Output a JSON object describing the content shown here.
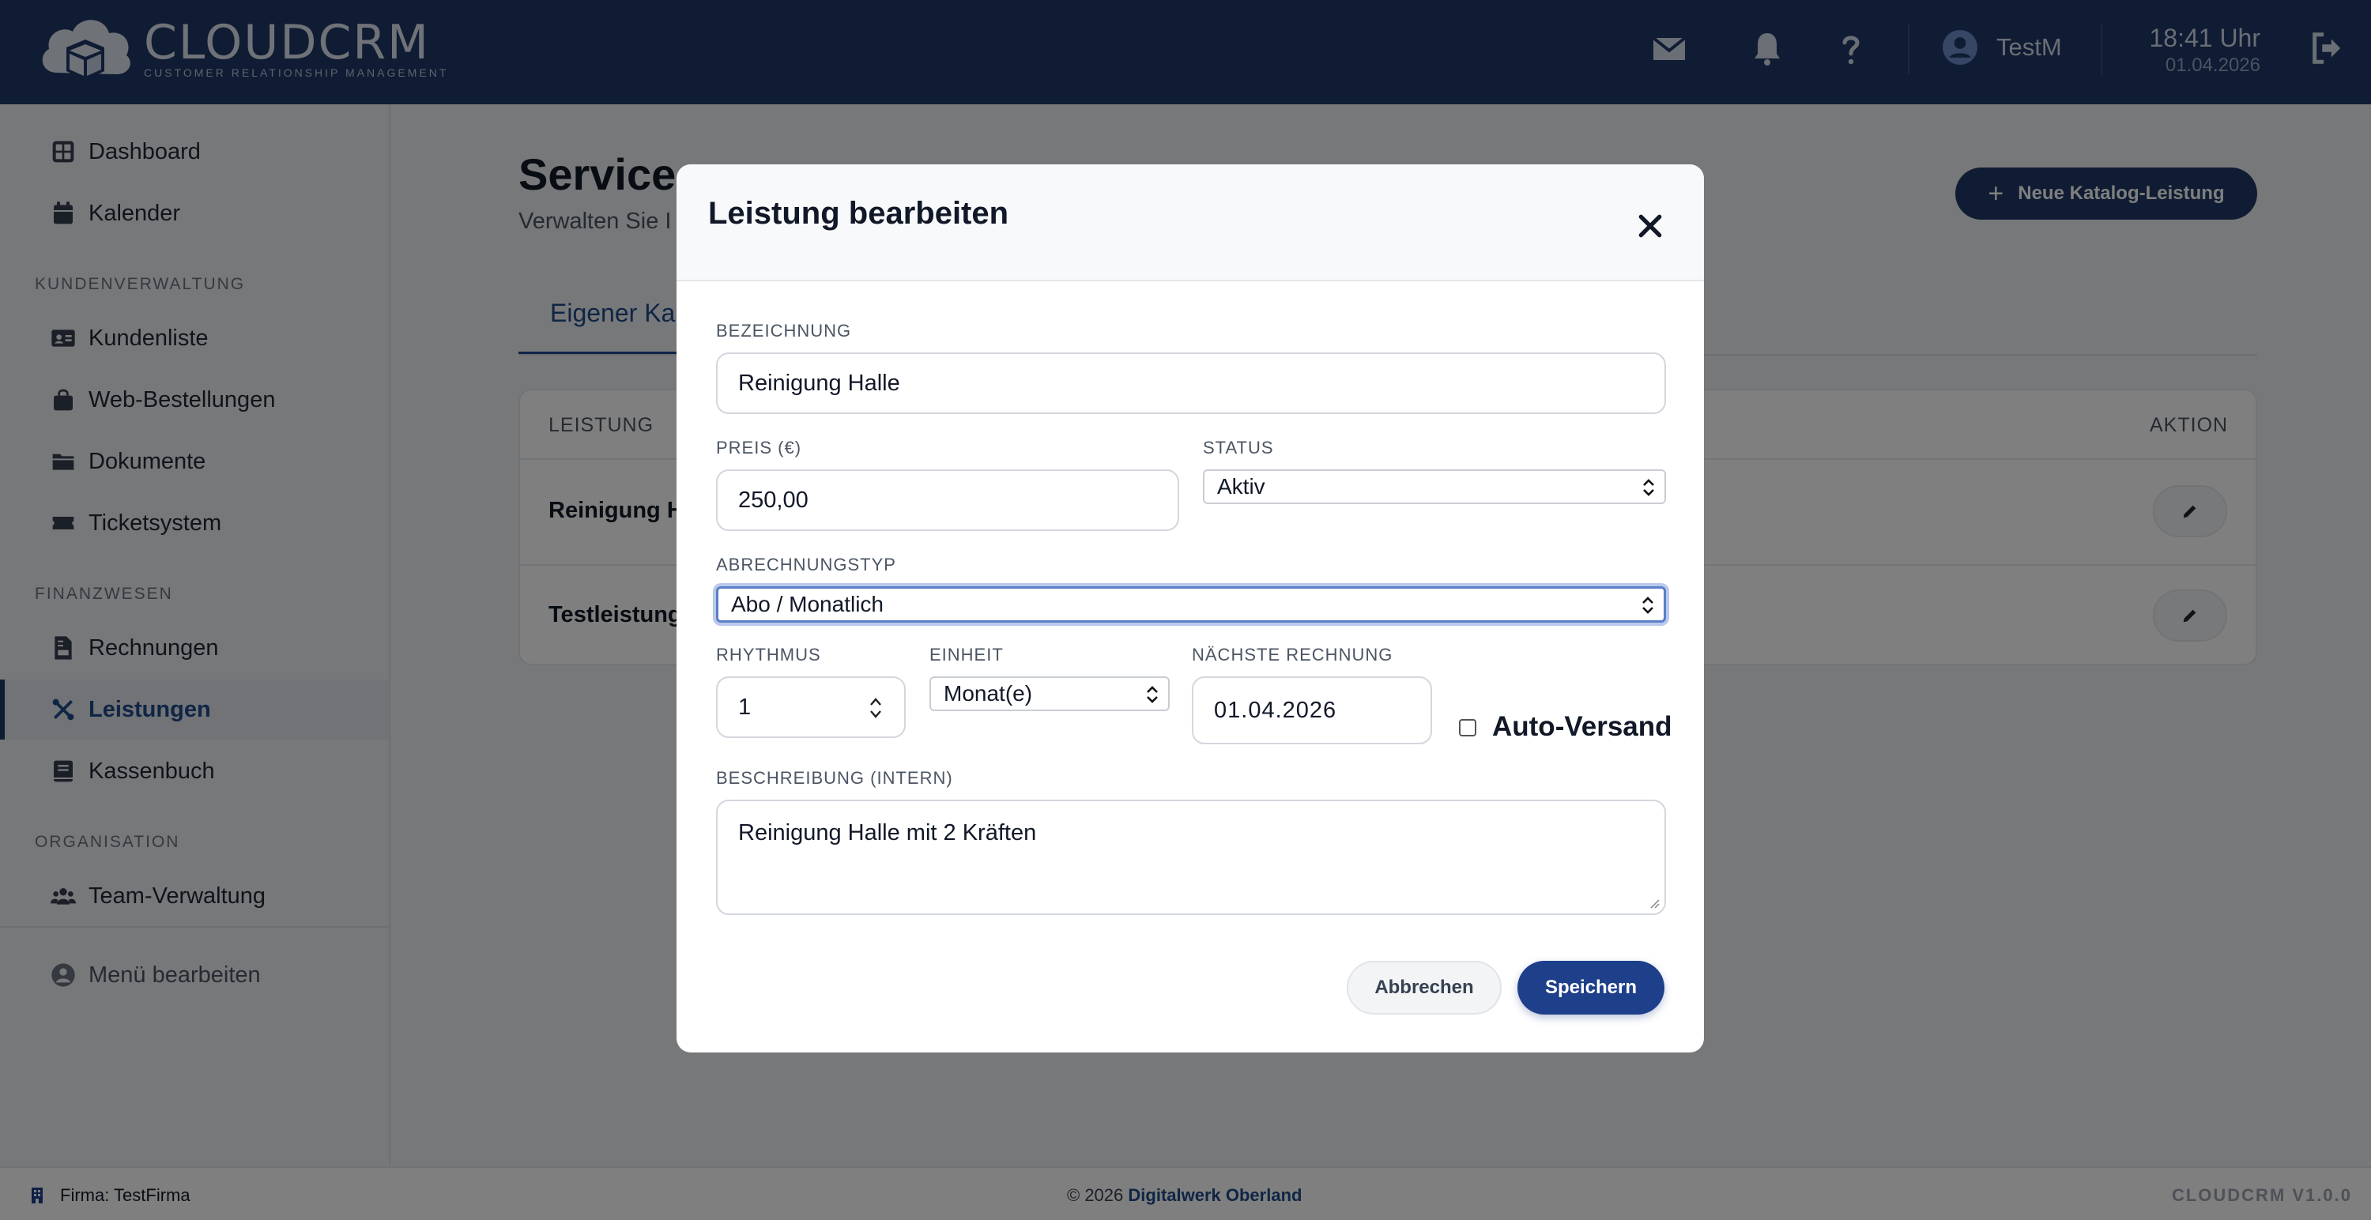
{
  "header": {
    "logo_title": "CLOUDCRM",
    "logo_subtitle": "CUSTOMER RELATIONSHIP MANAGEMENT",
    "icons": [
      "envelope-icon",
      "bell-icon",
      "question-icon",
      "user-avatar-icon",
      "logout-icon"
    ],
    "user_name": "TestM",
    "time": "18:41 Uhr",
    "date": "01.04.2026"
  },
  "sidebar": {
    "items_top": [
      {
        "label": "Dashboard",
        "icon": "dashboard-icon"
      },
      {
        "label": "Kalender",
        "icon": "calendar-icon"
      }
    ],
    "section_customers": "KUNDENVERWALTUNG",
    "items_customers": [
      {
        "label": "Kundenliste",
        "icon": "id-card-icon"
      },
      {
        "label": "Web-Bestellungen",
        "icon": "shopping-bag-icon"
      },
      {
        "label": "Dokumente",
        "icon": "folder-icon"
      },
      {
        "label": "Ticketsystem",
        "icon": "ticket-icon"
      }
    ],
    "section_finance": "FINANZWESEN",
    "items_finance": [
      {
        "label": "Rechnungen",
        "icon": "invoice-icon"
      },
      {
        "label": "Leistungen",
        "icon": "tools-icon",
        "active": true
      },
      {
        "label": "Kassenbuch",
        "icon": "book-icon"
      }
    ],
    "section_org": "ORGANISATION",
    "items_org": [
      {
        "label": "Team-Verwaltung",
        "icon": "users-icon"
      }
    ],
    "edit_menu": "Menü bearbeiten"
  },
  "main": {
    "title": "Service-Leistungen verwalten",
    "title_visible": "Service-",
    "subtitle_visible": "Verwalten Sie I",
    "new_button": "Neue Katalog-Leistung",
    "tab_visible": "Eigener Ka",
    "table": {
      "col_service": "LEISTUNG",
      "col_action": "AKTION",
      "rows_visible": [
        "Reinigung H",
        "Testleistung"
      ]
    }
  },
  "modal": {
    "title": "Leistung bearbeiten",
    "fields": {
      "name_label": "BEZEICHNUNG",
      "name_value": "Reinigung Halle",
      "price_label": "PREIS (€)",
      "price_value": "250,00",
      "status_label": "STATUS",
      "status_value": "Aktiv",
      "billing_label": "ABRECHNUNGSTYP",
      "billing_value": "Abo / Monatlich",
      "rhythm_label": "RHYTHMUS",
      "rhythm_value": "1",
      "unit_label": "EINHEIT",
      "unit_value": "Monat(e)",
      "next_invoice_label": "NÄCHSTE RECHNUNG",
      "next_invoice_value": "01.04.2026",
      "auto_send_label": "Auto-Versand",
      "auto_send_checked": false,
      "desc_label": "BESCHREIBUNG (INTERN)",
      "desc_value": "Reinigung Halle mit 2 Kräften"
    },
    "cancel": "Abbrechen",
    "save": "Speichern"
  },
  "footer": {
    "company": "Firma: TestFirma",
    "copyright_prefix": "© 2026 ",
    "copyright_link": "Digitalwerk Oberland",
    "version": "CLOUDCRM V1.0.0"
  },
  "colors": {
    "header_bg": "#1e3867",
    "accent": "#1f4a8a",
    "save_button": "#1e3f8a"
  }
}
